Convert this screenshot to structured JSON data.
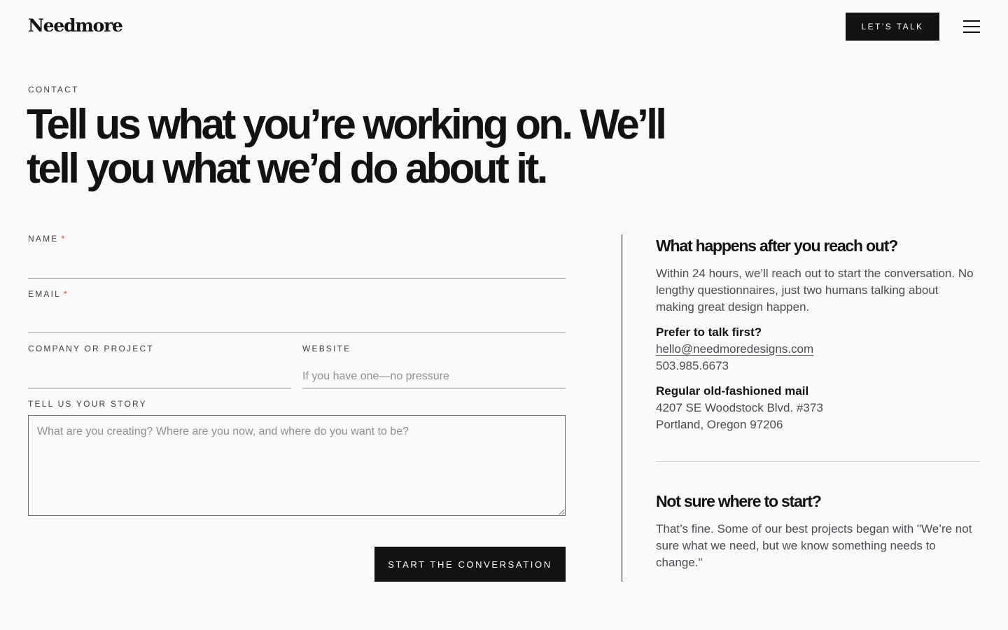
{
  "header": {
    "logo": "Needmore",
    "cta_label": "LET’S TALK",
    "menu_icon": "hamburger-menu-icon"
  },
  "hero": {
    "eyebrow": "CONTACT",
    "headline": "Tell us what you’re working on. We’ll tell you what we’d do about it."
  },
  "form": {
    "name": {
      "label": "NAME",
      "required_mark": "*",
      "value": "",
      "placeholder": ""
    },
    "email": {
      "label": "EMAIL",
      "required_mark": "*",
      "value": "",
      "placeholder": ""
    },
    "company": {
      "label": "COMPANY OR PROJECT",
      "value": "",
      "placeholder": ""
    },
    "website": {
      "label": "WEBSITE",
      "value": "",
      "placeholder": "If you have one—no pressure"
    },
    "story": {
      "label": "TELL US YOUR STORY",
      "value": "",
      "placeholder": "What are you creating? Where are you now, and where do you want to be?"
    },
    "submit_label": "START THE CONVERSATION"
  },
  "sidebar": {
    "after_heading": "What happens after you reach out?",
    "after_text": "Within 24 hours, we’ll reach out to start the conversation. No lengthy questionnaires, just two humans talking about making great design happen.",
    "talk_heading": "Prefer to talk first?",
    "email": "hello@needmoredesigns.com",
    "phone": "503.985.6673",
    "mail_heading": "Regular old-fashioned mail",
    "address_line1": "4207 SE Woodstock Blvd. #373",
    "address_line2": "Portland, Oregon 97206",
    "start_heading": "Not sure where to start?",
    "start_text": "That’s fine. Some of our best projects began with \"We’re not sure what we need, but we know something needs to change.\""
  },
  "colors": {
    "background": "#fafafa",
    "primary": "#111214",
    "required": "#e0462b",
    "muted_text": "#4a4c51"
  }
}
